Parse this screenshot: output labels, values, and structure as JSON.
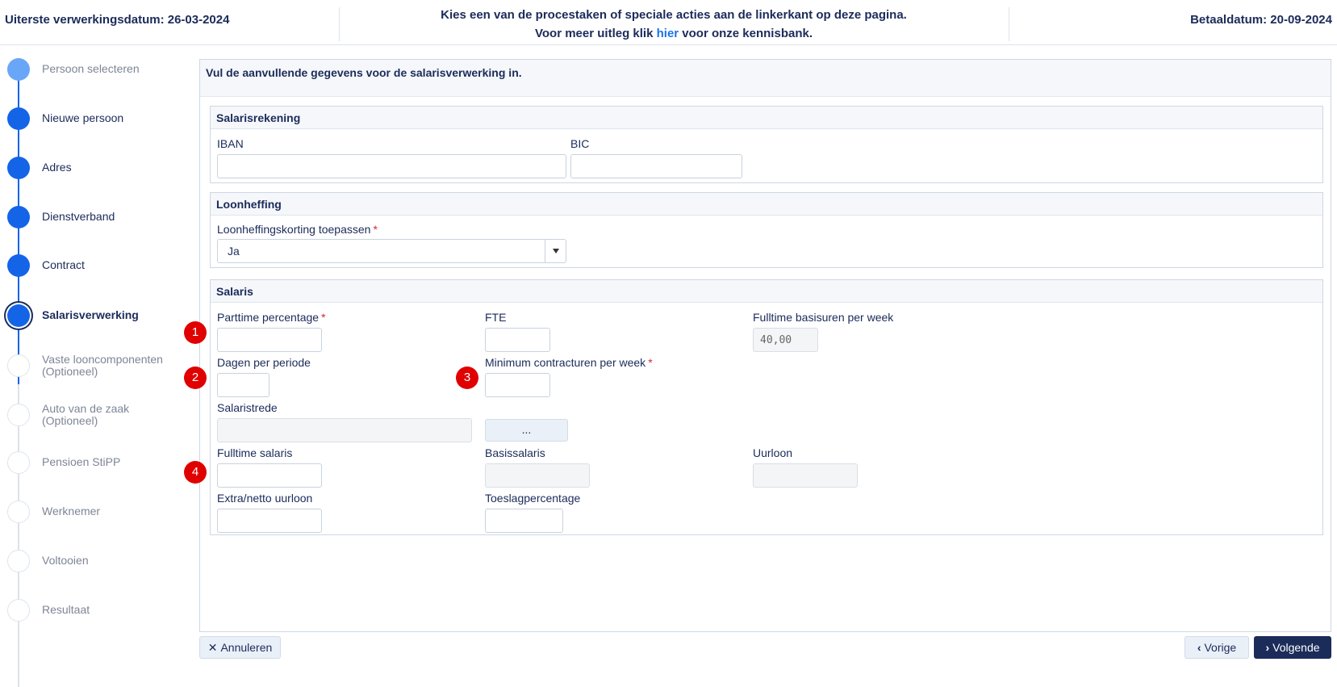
{
  "header": {
    "deadline": "Uiterste verwerkingsdatum: 26-03-2024",
    "instruction_line1": "Kies een van de procestaken of speciale acties aan de linkerkant op deze pagina.",
    "instruction_line2_pre": "Voor meer uitleg klik ",
    "instruction_link": "hier",
    "instruction_line2_post": " voor onze kennisbank.",
    "pay_date": "Betaaldatum: 20-09-2024"
  },
  "stepper": {
    "steps": [
      {
        "label": "Persoon selecteren",
        "state": "done-light"
      },
      {
        "label": "Nieuwe persoon",
        "state": "done"
      },
      {
        "label": "Adres",
        "state": "done"
      },
      {
        "label": "Dienstverband",
        "state": "done"
      },
      {
        "label": "Contract",
        "state": "done"
      },
      {
        "label": "Salarisverwerking",
        "state": "current"
      },
      {
        "label": "Vaste looncomponenten",
        "label2": "(Optioneel)",
        "state": "todo"
      },
      {
        "label": "Auto van de zaak",
        "label2": "(Optioneel)",
        "state": "todo"
      },
      {
        "label": "Pensioen StiPP",
        "state": "todo"
      },
      {
        "label": "Werknemer",
        "state": "todo"
      },
      {
        "label": "Voltooien",
        "state": "todo"
      },
      {
        "label": "Resultaat",
        "state": "todo"
      }
    ]
  },
  "main": {
    "instruction": "Vul de aanvullende gegevens voor de salarisverwerking in.",
    "salarisrekening": {
      "title": "Salarisrekening",
      "iban_label": "IBAN",
      "iban_value": "",
      "bic_label": "BIC",
      "bic_value": ""
    },
    "loonheffing": {
      "title": "Loonheffing",
      "korting_label": "Loonheffingskorting toepassen",
      "korting_required": "*",
      "korting_value": "Ja"
    },
    "salaris": {
      "title": "Salaris",
      "parttime_label": "Parttime percentage",
      "parttime_required": "*",
      "fte_label": "FTE",
      "fulltime_uren_label": "Fulltime basisuren per week",
      "fulltime_uren_value": "40,00",
      "dagen_label": "Dagen per periode",
      "min_uren_label": "Minimum contracturen per week",
      "min_uren_required": "*",
      "trede_label": "Salaristrede",
      "trede_button": "...",
      "fulltime_salaris_label": "Fulltime salaris",
      "basis_label": "Basissalaris",
      "uurloon_label": "Uurloon",
      "extra_label": "Extra/netto uurloon",
      "toeslag_label": "Toeslagpercentage"
    },
    "markers": [
      "1",
      "2",
      "3",
      "4"
    ]
  },
  "footer": {
    "cancel_label": "Annuleren",
    "prev_label": "Vorige",
    "next_label": "Volgende"
  },
  "colors": {
    "primary": "#1464e8",
    "navy": "#1b2b5a",
    "marker_red": "#e00000"
  }
}
